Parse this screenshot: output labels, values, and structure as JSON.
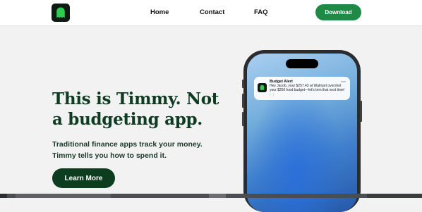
{
  "nav": {
    "logo_icon": "ghost-icon",
    "links": [
      "Home",
      "Contact",
      "FAQ"
    ],
    "download_label": "Download"
  },
  "hero": {
    "title": "This is Timmy. Not a budgeting app.",
    "subtitle": "Traditional finance apps track your money. Timmy tells you how to spend it.",
    "cta_label": "Learn More"
  },
  "notification": {
    "title": "Budget Alert",
    "time": "now",
    "body": "Hey Jacob, your $257.43 at Walmart overshot your $250 food budget—let's trim that next time! 🍽️"
  },
  "colors": {
    "brand_dark": "#0e3b22",
    "download_green": "#1f8a45",
    "cta_dark": "#0d3d1f",
    "background": "#f2f2f2"
  }
}
